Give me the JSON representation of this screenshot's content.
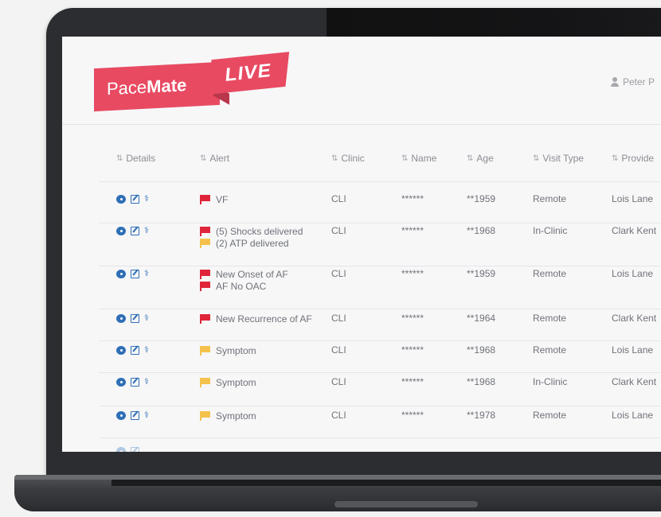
{
  "header": {
    "logo_main_a": "Pace",
    "logo_main_b": "Mate",
    "logo_live": "LIVE",
    "user_name": "Peter P"
  },
  "columns": [
    "Details",
    "Alert",
    "Clinic",
    "Name",
    "Age",
    "Visit Type",
    "Provide"
  ],
  "icons": {
    "sort": "sort-icon",
    "chat": "chat-icon",
    "edit": "edit-icon",
    "person": "person-icon",
    "flag": "flag-icon",
    "user": "user-icon"
  },
  "colors": {
    "brand": "#e84a62",
    "flag_red": "#e0243a",
    "flag_yellow": "#f4c24c",
    "icon_blue": "#2f6fb6"
  },
  "rows": [
    {
      "alerts": [
        {
          "text": "VF",
          "level": "red"
        }
      ],
      "clinic": "CLI",
      "name": "******",
      "age": "**1959",
      "visit": "Remote",
      "provider": "Lois Lane"
    },
    {
      "alerts": [
        {
          "text": "(5) Shocks delivered",
          "level": "red"
        },
        {
          "text": "(2) ATP delivered",
          "level": "yellow"
        }
      ],
      "clinic": "CLI",
      "name": "******",
      "age": "**1968",
      "visit": "In-Clinic",
      "provider": "Clark Kent"
    },
    {
      "alerts": [
        {
          "text": "New Onset of AF",
          "level": "red"
        },
        {
          "text": "AF No OAC",
          "level": "red"
        }
      ],
      "clinic": "CLI",
      "name": "******",
      "age": "**1959",
      "visit": "Remote",
      "provider": "Lois Lane"
    },
    {
      "alerts": [
        {
          "text": "New Recurrence of AF",
          "level": "red"
        }
      ],
      "clinic": "CLI",
      "name": "******",
      "age": "**1964",
      "visit": "Remote",
      "provider": "Clark Kent"
    },
    {
      "alerts": [
        {
          "text": "Symptom",
          "level": "yellow"
        }
      ],
      "clinic": "CLI",
      "name": "******",
      "age": "**1968",
      "visit": "Remote",
      "provider": "Lois Lane"
    },
    {
      "alerts": [
        {
          "text": "Symptom",
          "level": "yellow"
        }
      ],
      "clinic": "CLI",
      "name": "******",
      "age": "**1968",
      "visit": "In-Clinic",
      "provider": "Clark Kent"
    },
    {
      "alerts": [
        {
          "text": "Symptom",
          "level": "yellow"
        }
      ],
      "clinic": "CLI",
      "name": "******",
      "age": "**1978",
      "visit": "Remote",
      "provider": "Lois Lane"
    }
  ]
}
